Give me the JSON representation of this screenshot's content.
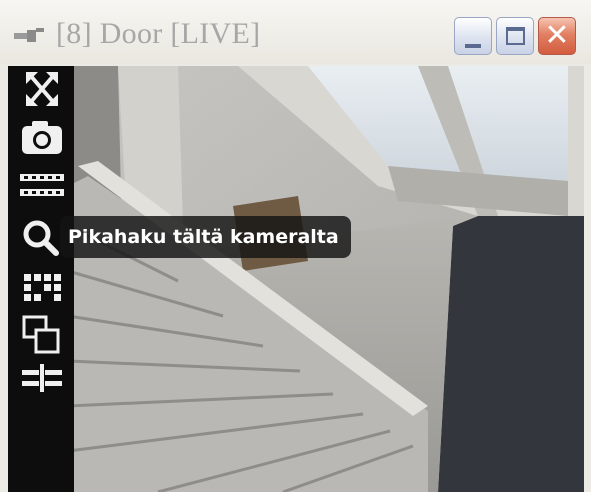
{
  "window": {
    "title": "[8] Door [LIVE]",
    "title_icon": "camera-icon",
    "controls": {
      "minimize": "minimize-icon",
      "maximize": "maximize-icon",
      "close": "close-icon",
      "close_glyph": "✕"
    }
  },
  "camera": {
    "feed": "live camera view of a staircase and skylight"
  },
  "toolbar": {
    "tools": [
      {
        "name": "fullscreen",
        "icon": "fullscreen-icon"
      },
      {
        "name": "snapshot",
        "icon": "camera-snapshot-icon"
      },
      {
        "name": "film-strip",
        "icon": "film-strip-icon"
      },
      {
        "name": "quick-search",
        "icon": "search-icon"
      },
      {
        "name": "grid-view",
        "icon": "grid-icon"
      },
      {
        "name": "overlap-windows",
        "icon": "overlap-icon"
      },
      {
        "name": "split-view",
        "icon": "split-icon"
      }
    ],
    "tooltip": "Pikahaku tältä kameralta"
  },
  "colors": {
    "title_text": "#a7a7a7",
    "close_button": "#d35b3e",
    "toolbar_bg": "#0d0d0d"
  }
}
